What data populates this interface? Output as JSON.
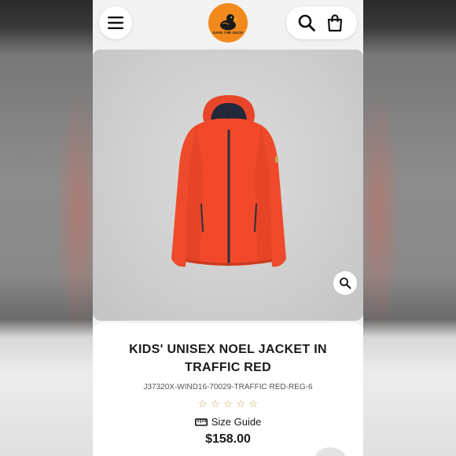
{
  "header": {
    "menu_icon": "hamburger-menu-icon",
    "logo_icon": "duck-logo-icon",
    "logo_text": "SAVE THE DUCK",
    "search_icon": "search-icon",
    "bag_icon": "shopping-bag-icon"
  },
  "product": {
    "image_icon": "orange-jacket-image",
    "zoom_icon": "zoom-magnifier-icon",
    "title": "KIDS' UNISEX NOEL JACKET IN TRAFFIC RED",
    "sku": "J37320X-WIND16-70029-TRAFFIC RED-REG-6",
    "rating_stars": [
      "☆",
      "☆",
      "☆",
      "☆",
      "☆"
    ],
    "rating_value": 0,
    "size_guide_icon": "ruler-icon",
    "size_guide_label": "Size Guide",
    "price": "$158.00"
  },
  "colors": {
    "brand_orange": "#f28a1d",
    "jacket_red": "#f2492a",
    "star_gold": "#c9a45a"
  }
}
